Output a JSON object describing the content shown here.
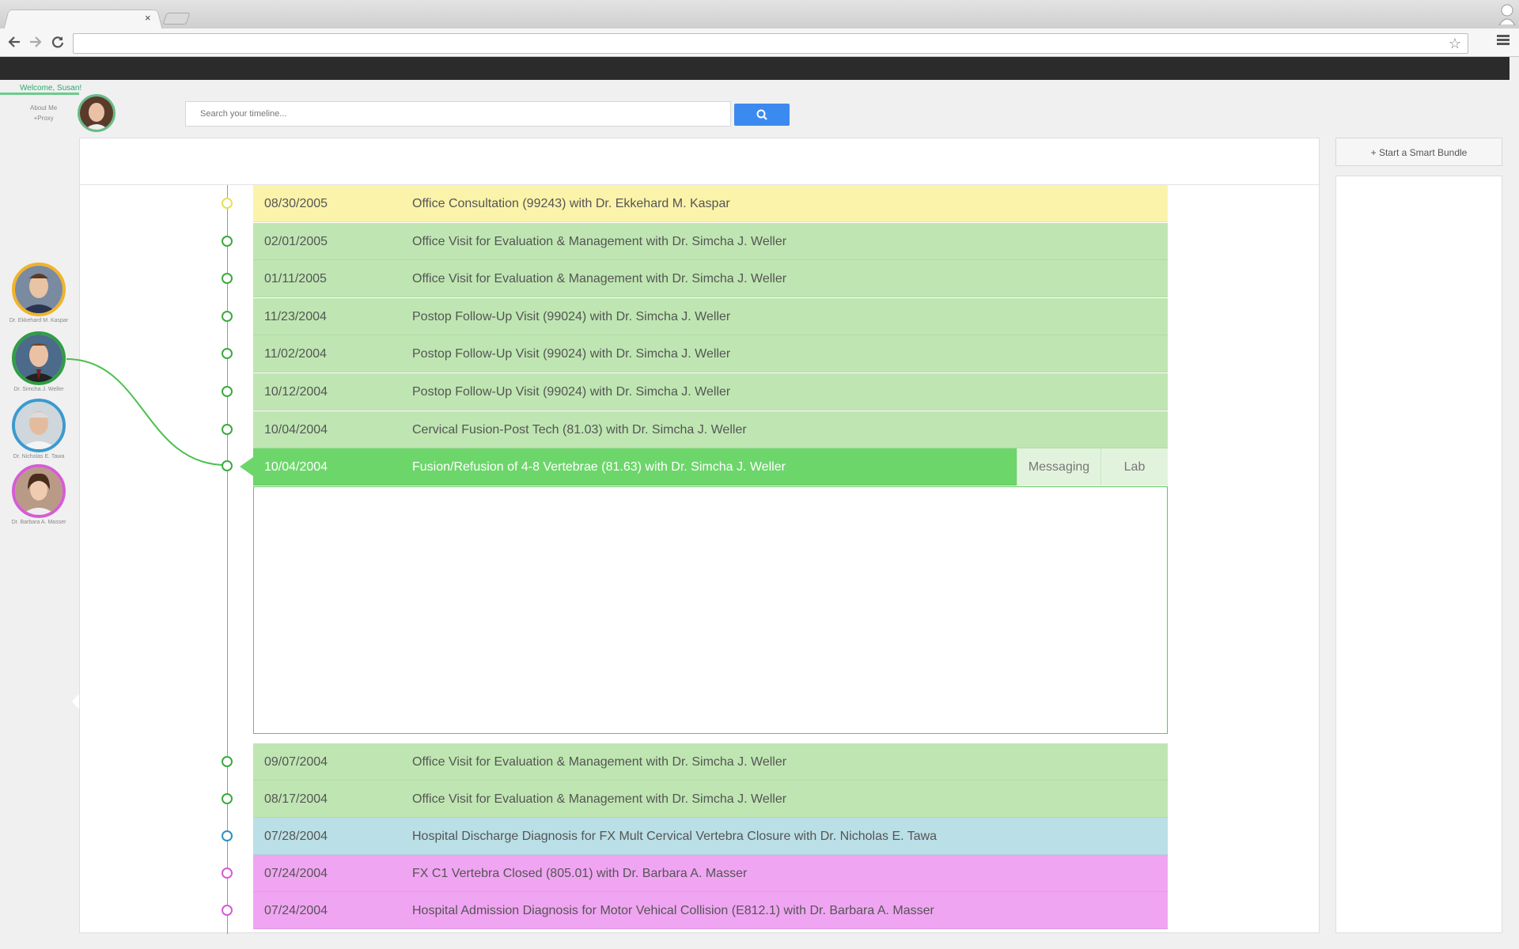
{
  "browser": {
    "tab_close": "×",
    "icons": [
      "back-icon",
      "forward-icon",
      "reload-icon",
      "star-icon",
      "menu-icon",
      "profile-icon"
    ]
  },
  "header": {
    "welcome": "Welcome, Susan!",
    "about_me": "About Me",
    "proxy": "+Proxy",
    "search_placeholder": "Search your timeline..."
  },
  "sidebar": {
    "smart_bundle_label": "+ Start a Smart Bundle"
  },
  "doctors": [
    {
      "name": "Dr. Ekkehard M. Kaspar",
      "color": "#f0b429"
    },
    {
      "name": "Dr. Simcha J. Weller",
      "color": "#2e9e43"
    },
    {
      "name": "Dr. Nicholas E. Tawa",
      "color": "#3a9ad0"
    },
    {
      "name": "Dr. Barbara A. Masser",
      "color": "#d65cd6"
    }
  ],
  "timeline": [
    {
      "date": "08/30/2005",
      "desc": "Office Consultation (99243) with Dr. Ekkehard M. Kaspar",
      "color": "#fbf3a9",
      "dot": "#e8df56"
    },
    {
      "date": "02/01/2005",
      "desc": "Office Visit for Evaluation & Management with Dr. Simcha J. Weller",
      "color": "#bfe6b2",
      "dot": "#3caa3e"
    },
    {
      "date": "01/11/2005",
      "desc": "Office Visit for Evaluation & Management with Dr. Simcha J. Weller",
      "color": "#bfe6b2",
      "dot": "#3caa3e"
    },
    {
      "date": "11/23/2004",
      "desc": "Postop Follow-Up Visit (99024) with Dr. Simcha J. Weller",
      "color": "#bfe6b2",
      "dot": "#3caa3e"
    },
    {
      "date": "11/02/2004",
      "desc": "Postop Follow-Up Visit (99024) with Dr. Simcha J. Weller",
      "color": "#bfe6b2",
      "dot": "#3caa3e"
    },
    {
      "date": "10/12/2004",
      "desc": "Postop Follow-Up Visit (99024) with Dr. Simcha J. Weller",
      "color": "#bfe6b2",
      "dot": "#3caa3e"
    },
    {
      "date": "10/04/2004",
      "desc": "Cervical Fusion-Post Tech (81.03) with Dr. Simcha J. Weller",
      "color": "#bfe6b2",
      "dot": "#3caa3e"
    }
  ],
  "active_entry": {
    "date": "10/04/2004",
    "desc": "Fusion/Refusion of 4-8 Vertebrae (81.63) with Dr. Simcha J. Weller",
    "messaging_label": "Messaging",
    "lab_label": "Lab",
    "color": "#6cd66a"
  },
  "timeline_after": [
    {
      "date": "09/07/2004",
      "desc": "Office Visit for Evaluation & Management with Dr. Simcha J. Weller",
      "color": "#bfe6b2",
      "dot": "#3caa3e"
    },
    {
      "date": "08/17/2004",
      "desc": "Office Visit for Evaluation & Management with Dr. Simcha J. Weller",
      "color": "#bfe6b2",
      "dot": "#3caa3e"
    },
    {
      "date": "07/28/2004",
      "desc": "Hospital Discharge Diagnosis for FX Mult Cervical Vertebra Closure with Dr. Nicholas E. Tawa",
      "color": "#badfe6",
      "dot": "#2f8fc4"
    },
    {
      "date": "07/24/2004",
      "desc": "FX C1 Vertebra Closed (805.01) with Dr. Barbara A. Masser",
      "color": "#f0a5f2",
      "dot": "#d65cd6"
    },
    {
      "date": "07/24/2004",
      "desc": "Hospital Admission Diagnosis for Motor Vehical Collision (E812.1) with Dr. Barbara A. Masser",
      "color": "#f0a5f2",
      "dot": "#d65cd6"
    }
  ]
}
